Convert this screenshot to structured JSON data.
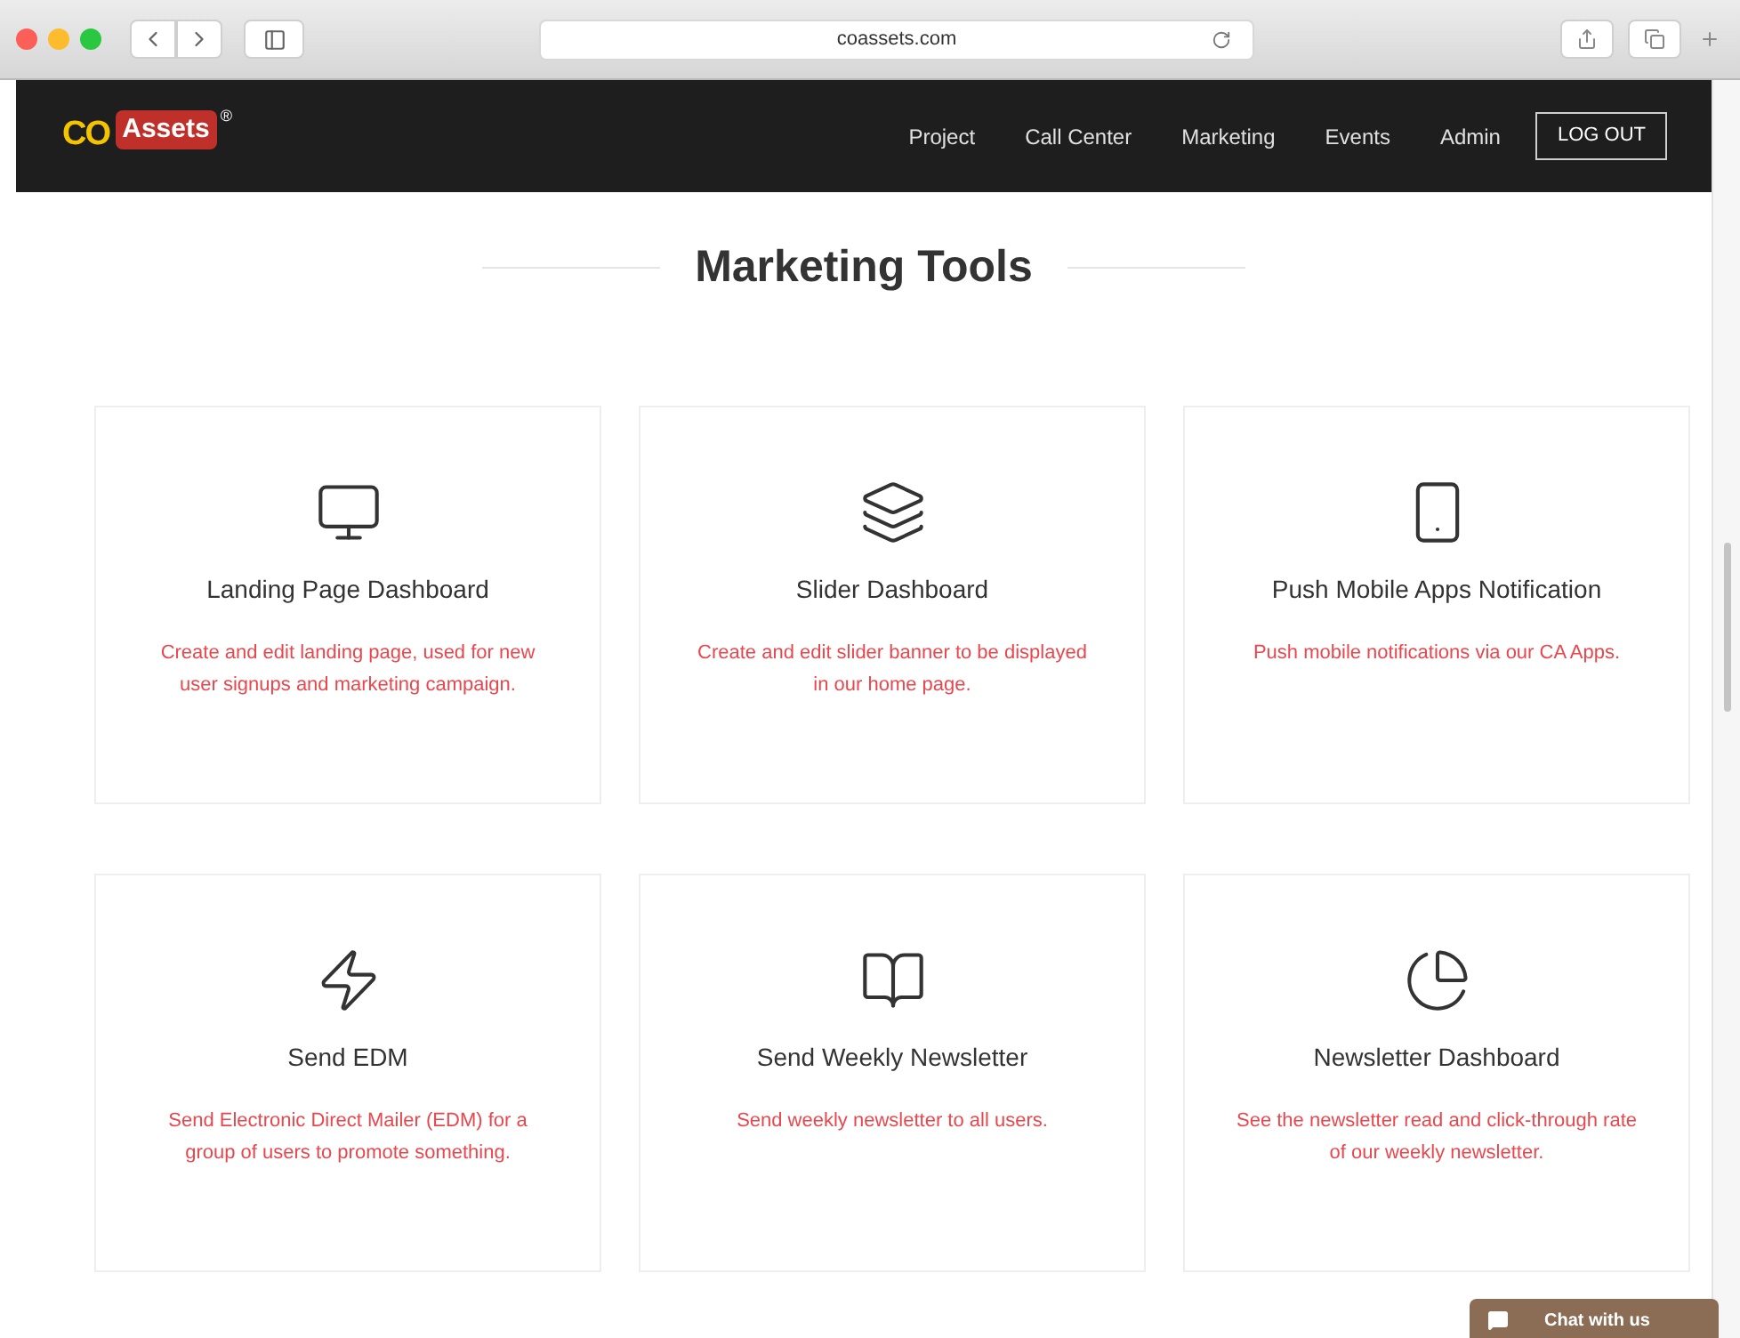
{
  "browser": {
    "address": "coassets.com"
  },
  "logo": {
    "mark": "CO",
    "name": "Assets",
    "registered": "®"
  },
  "nav": {
    "items": [
      "Project",
      "Call Center",
      "Marketing",
      "Events",
      "Admin"
    ],
    "logout": "LOG OUT"
  },
  "heading": "Marketing Tools",
  "tools": [
    {
      "kind": "monitor",
      "title": "Landing Page Dashboard",
      "description": "Create and edit landing page, used for new user signups and marketing campaign."
    },
    {
      "kind": "layers",
      "title": "Slider Dashboard",
      "description": "Create and edit slider banner to be displayed in our home page."
    },
    {
      "kind": "phone",
      "title": "Push Mobile Apps Notification",
      "description": "Push mobile notifications via our CA Apps."
    },
    {
      "kind": "bolt",
      "title": "Send EDM",
      "description": "Send Electronic Direct Mailer (EDM) for a group of users to promote something."
    },
    {
      "kind": "book",
      "title": "Send Weekly Newsletter",
      "description": "Send weekly newsletter to all users."
    },
    {
      "kind": "pie",
      "title": "Newsletter Dashboard",
      "description": "See the newsletter read and click-through rate of our weekly newsletter."
    }
  ],
  "chat": {
    "label": "Chat with us"
  }
}
